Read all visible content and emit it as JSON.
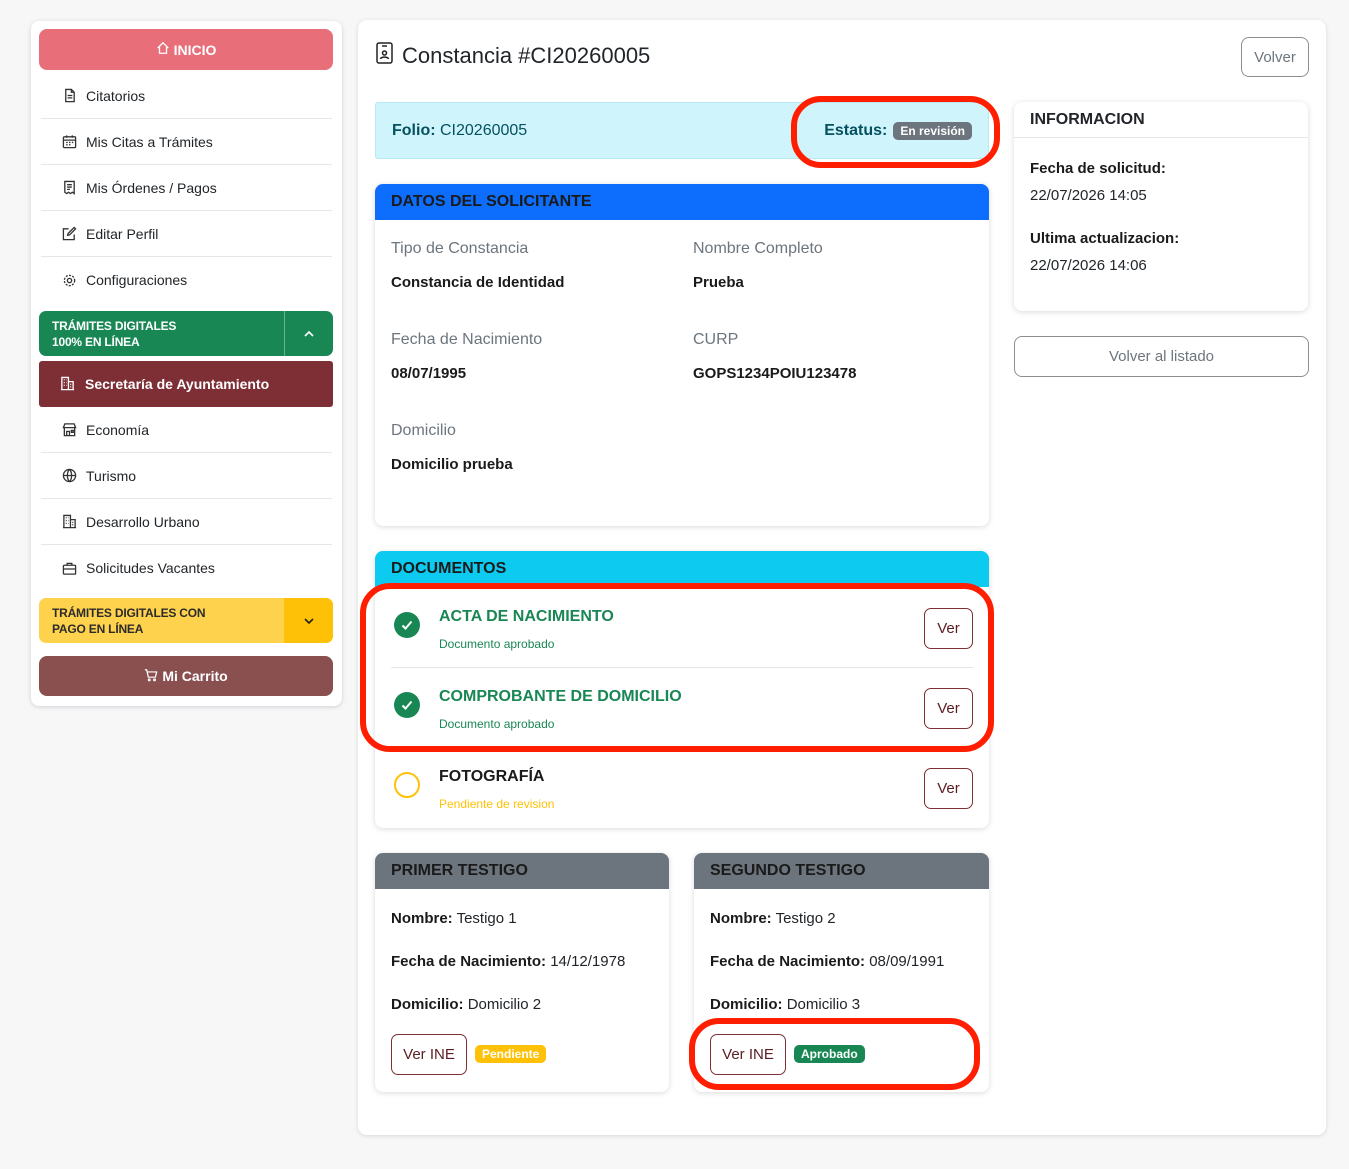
{
  "sidebar": {
    "inicio_label": "INICIO",
    "nav_items": [
      {
        "label": "Citatorios",
        "icon": "document-icon"
      },
      {
        "label": "Mis Citas a Trámites",
        "icon": "calendar-icon"
      },
      {
        "label": "Mis Órdenes / Pagos",
        "icon": "receipt-icon"
      },
      {
        "label": "Editar Perfil",
        "icon": "edit-icon"
      },
      {
        "label": "Configuraciones",
        "icon": "gear-icon"
      }
    ],
    "section_online": {
      "line1": "TRÁMITES DIGITALES",
      "line2": "100% EN LÍNEA"
    },
    "active_item": "Secretaría de Ayuntamiento",
    "sub_items": [
      {
        "label": "Economía",
        "icon": "shop-icon"
      },
      {
        "label": "Turismo",
        "icon": "globe-icon"
      },
      {
        "label": "Desarrollo Urbano",
        "icon": "building-icon"
      },
      {
        "label": "Solicitudes Vacantes",
        "icon": "briefcase-icon"
      }
    ],
    "section_payment": {
      "line1": "TRÁMITES DIGITALES CON",
      "line2": "PAGO EN LÍNEA"
    },
    "cart_label": "Mi Carrito"
  },
  "header": {
    "title": "Constancia #CI20260005",
    "back_label": "Volver"
  },
  "folio": {
    "label": "Folio:",
    "value": "CI20260005",
    "status_label": "Estatus:",
    "status_value": "En revisión"
  },
  "solicitante": {
    "heading": "DATOS DEL SOLICITANTE",
    "fields": [
      {
        "label": "Tipo de Constancia",
        "value": "Constancia de Identidad"
      },
      {
        "label": "Nombre Completo",
        "value": "Prueba"
      },
      {
        "label": "Fecha de Nacimiento",
        "value": "08/07/1995"
      },
      {
        "label": "CURP",
        "value": "GOPS1234POIU123478"
      },
      {
        "label": "Domicilio",
        "value": "Domicilio prueba"
      }
    ]
  },
  "documentos": {
    "heading": "DOCUMENTOS",
    "view_label": "Ver",
    "items": [
      {
        "title": "ACTA DE NACIMIENTO",
        "status": "Documento aprobado"
      },
      {
        "title": "COMPROBANTE DE DOMICILIO",
        "status": "Documento aprobado"
      },
      {
        "title": "FOTOGRAFÍA",
        "status": "Pendiente de revision"
      }
    ]
  },
  "testigos": [
    {
      "heading": "PRIMER TESTIGO",
      "nombre_label": "Nombre:",
      "nombre": "Testigo 1",
      "fecha_label": "Fecha de Nacimiento:",
      "fecha": "14/12/1978",
      "domicilio_label": "Domicilio:",
      "domicilio": "Domicilio 2",
      "ine_label": "Ver INE",
      "badge": "Pendiente"
    },
    {
      "heading": "SEGUNDO TESTIGO",
      "nombre_label": "Nombre:",
      "nombre": "Testigo 2",
      "fecha_label": "Fecha de Nacimiento:",
      "fecha": "08/09/1991",
      "domicilio_label": "Domicilio:",
      "domicilio": "Domicilio 3",
      "ine_label": "Ver INE",
      "badge": "Aprobado"
    }
  ],
  "informacion": {
    "heading": "INFORMACION",
    "solicitud_label": "Fecha de solicitud:",
    "solicitud_value": "22/07/2026 14:05",
    "actualizacion_label": "Ultima actualizacion:",
    "actualizacion_value": "22/07/2026 14:06",
    "back_list_label": "Volver al listado"
  },
  "colors": {
    "inicio": "#e86f7a",
    "active_item": "#7d2f35",
    "online_section": "#198754",
    "payment_section": "#ffd24d",
    "cart": "#8a4f4f",
    "approved": "#198754",
    "pending": "#ffc107",
    "highlight": "#ff1f00"
  }
}
